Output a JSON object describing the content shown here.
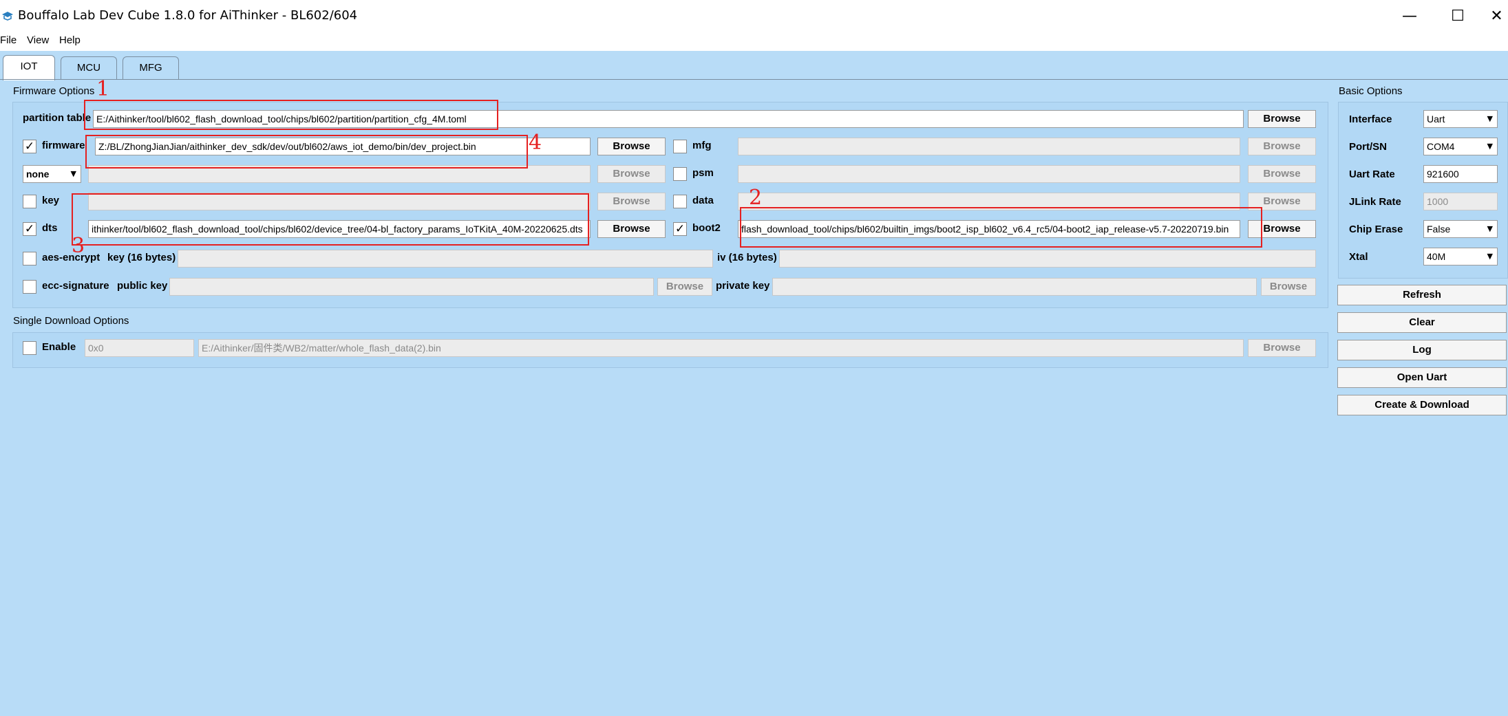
{
  "window": {
    "title": "Bouffalo Lab Dev Cube 1.8.0 for AiThinker - BL602/604",
    "minimize": "—",
    "maximize": "☐",
    "close": "✕"
  },
  "menu": {
    "file": "File",
    "view": "View",
    "help": "Help"
  },
  "tabs": [
    "IOT",
    "MCU",
    "MFG"
  ],
  "firmware_options": {
    "label": "Firmware Options",
    "partition_table": {
      "label": "partition table",
      "value": "E:/Aithinker/tool/bl602_flash_download_tool/chips/bl602/partition/partition_cfg_4M.toml",
      "button": "Browse"
    },
    "firmware": {
      "label": "firmware",
      "value": "Z:/BL/ZhongJianJian/aithinker_dev_sdk/dev/out/bl602/aws_iot_demo/bin/dev_project.bin",
      "button": "Browse"
    },
    "mfg": {
      "label": "mfg",
      "value": "",
      "button": "Browse"
    },
    "none_select": {
      "value": "none",
      "button": "Browse"
    },
    "psm": {
      "label": "psm",
      "value": "",
      "button": "Browse"
    },
    "key": {
      "label": "key",
      "value": "",
      "button": "Browse"
    },
    "data": {
      "label": "data",
      "value": "",
      "button": "Browse"
    },
    "dts": {
      "label": "dts",
      "value": "ithinker/tool/bl602_flash_download_tool/chips/bl602/device_tree/04-bl_factory_params_IoTKitA_40M-20220625.dts",
      "button": "Browse"
    },
    "boot2": {
      "label": "boot2",
      "value": "flash_download_tool/chips/bl602/builtin_imgs/boot2_isp_bl602_v6.4_rc5/04-boot2_iap_release-v5.7-20220719.bin",
      "button": "Browse"
    },
    "aes_encrypt": {
      "label": "aes-encrypt",
      "key_label": "key (16 bytes)",
      "iv_label": "iv (16 bytes)"
    },
    "ecc_signature": {
      "label": "ecc-signature",
      "public_key_label": "public key",
      "private_key_label": "private key",
      "button": "Browse"
    }
  },
  "single_download": {
    "label": "Single Download Options",
    "enable_label": "Enable",
    "address": "0x0",
    "file": "E:/Aithinker/固件类/WB2/matter/whole_flash_data(2).bin",
    "button": "Browse"
  },
  "basic_options": {
    "label": "Basic Options",
    "interface": {
      "label": "Interface",
      "value": "Uart"
    },
    "port": {
      "label": "Port/SN",
      "value": "COM4"
    },
    "uart_rate": {
      "label": "Uart Rate",
      "value": "921600"
    },
    "jlink_rate": {
      "label": "JLink Rate",
      "value": "1000"
    },
    "chip_erase": {
      "label": "Chip Erase",
      "value": "False"
    },
    "xtal": {
      "label": "Xtal",
      "value": "40M"
    }
  },
  "actions": {
    "refresh": "Refresh",
    "clear": "Clear",
    "log": "Log",
    "open_uart": "Open Uart",
    "create_download": "Create & Download"
  },
  "annotations": [
    "1",
    "2",
    "3",
    "4"
  ],
  "check": "✓",
  "colors": {
    "background": "#b8dcf7",
    "annotation": "#e52020"
  }
}
